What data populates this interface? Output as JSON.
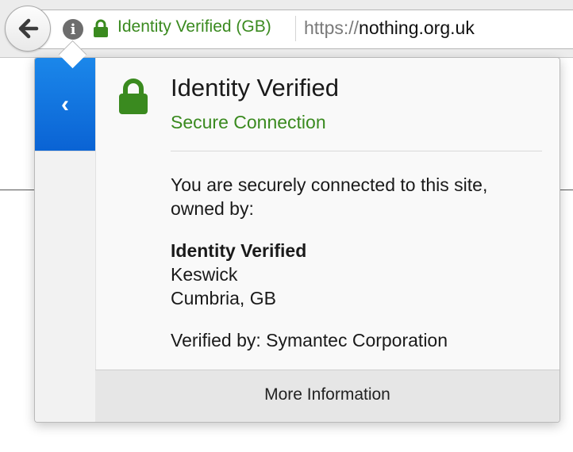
{
  "toolbar": {
    "back_icon": "back-arrow-icon",
    "info_icon": "info-icon",
    "info_glyph": "i",
    "identity_label": "Identity Verified (GB)",
    "url_scheme": "https://",
    "url_domain": "nothing.org.uk"
  },
  "popup": {
    "side_back_glyph": "‹",
    "title": "Identity Verified",
    "subtitle": "Secure Connection",
    "description": "You are securely connected to this site, owned by:",
    "owner_name": "Identity Verified",
    "owner_city": "Keswick",
    "owner_region": "Cumbria, GB",
    "verified_by": "Verified by: Symantec Corporation",
    "more_info_label": "More Information"
  },
  "colors": {
    "secure_green": "#3a8a1f",
    "back_panel_blue": "#0a63d4"
  }
}
